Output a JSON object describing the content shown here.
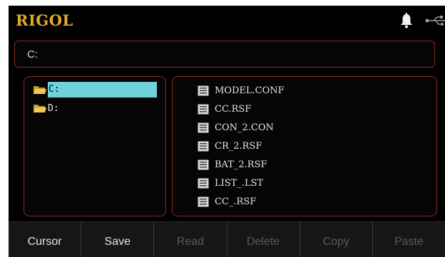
{
  "header": {
    "brand": "RIGOL",
    "icons": [
      "bell-icon",
      "usb-icon"
    ]
  },
  "path_bar": {
    "value": "C:"
  },
  "directories": [
    {
      "label": "C:",
      "selected": true
    },
    {
      "label": "D:",
      "selected": false
    }
  ],
  "files": [
    {
      "name": "MODEL.CONF"
    },
    {
      "name": "CC.RSF"
    },
    {
      "name": "CON_2.CON"
    },
    {
      "name": "CR_2.RSF"
    },
    {
      "name": "BAT_2.RSF"
    },
    {
      "name": "LIST_.LST"
    },
    {
      "name": "CC_.RSF"
    }
  ],
  "softkeys": [
    {
      "label": "Cursor",
      "enabled": true
    },
    {
      "label": "Save",
      "enabled": true
    },
    {
      "label": "Read",
      "enabled": false
    },
    {
      "label": "Delete",
      "enabled": false
    },
    {
      "label": "Copy",
      "enabled": false
    },
    {
      "label": "Paste",
      "enabled": false
    }
  ],
  "colors": {
    "brand": "#e2ac2b",
    "selection": "#6fd1dc",
    "panel_border": "#8a2a20",
    "disabled_text": "#5a5a5a"
  }
}
